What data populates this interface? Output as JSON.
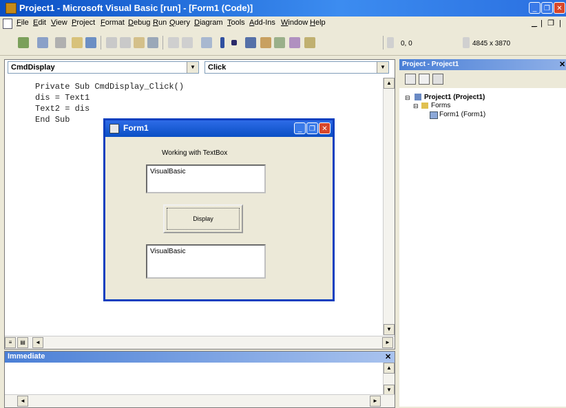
{
  "window": {
    "title": "Project1 - Microsoft Visual Basic [run] - [Form1 (Code)]",
    "min": "_",
    "restore": "❐",
    "close": "✕",
    "mdi_controls": "_ | ❐ | ✕"
  },
  "menu": [
    "File",
    "Edit",
    "View",
    "Project",
    "Format",
    "Debug",
    "Run",
    "Query",
    "Diagram",
    "Tools",
    "Add-Ins",
    "Window",
    "Help"
  ],
  "toolbar": {
    "position": "0, 0",
    "size": "4845 x 3870"
  },
  "code": {
    "object_combo": "CmdDisplay",
    "proc_combo": "Click",
    "lines": [
      "Private Sub CmdDisplay_Click()",
      "dis = Text1",
      "Text2 = dis",
      "End Sub"
    ]
  },
  "form1": {
    "title": "Form1",
    "label": "Working with TextBox",
    "text1": "VisualBasic",
    "button": "Display",
    "text2": "VisualBasic"
  },
  "project": {
    "title": "Project - Project1",
    "tree": [
      "Project1 (Project1)",
      "Forms",
      "Form1 (Form1)"
    ]
  },
  "immediate": {
    "title": "Immediate"
  }
}
